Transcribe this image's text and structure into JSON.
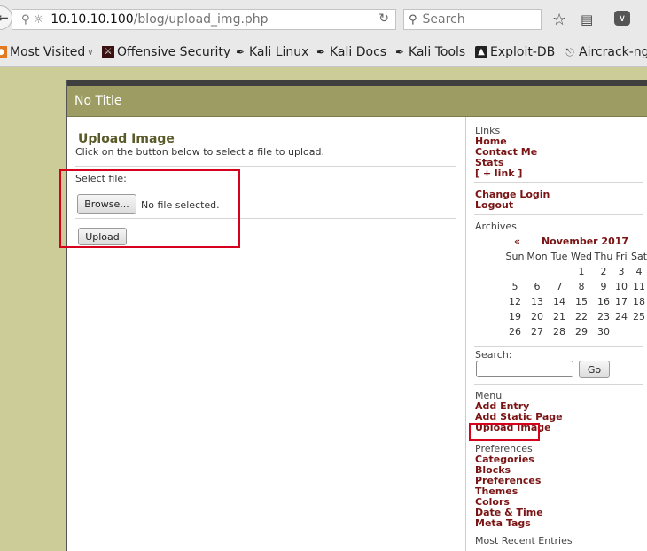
{
  "browser": {
    "url_host": "10.10.10.100",
    "url_path": "/blog/upload_img.php",
    "search_placeholder": "Search",
    "bookmarks": [
      "Most Visited",
      "Offensive Security",
      "Kali Linux",
      "Kali Docs",
      "Kali Tools",
      "Exploit-DB",
      "Aircrack-ng"
    ]
  },
  "page": {
    "header_title": "No Title",
    "upload": {
      "title": "Upload Image",
      "instruction": "Click on the button below to select a file to upload.",
      "select_label": "Select file:",
      "browse_label": "Browse...",
      "no_file": "No file selected.",
      "upload_label": "Upload"
    }
  },
  "sidebar": {
    "links_head": "Links",
    "links": [
      "Home",
      "Contact Me",
      "Stats",
      "[ + link ]"
    ],
    "account": [
      "Change Login",
      "Logout"
    ],
    "archives_head": "Archives",
    "calendar": {
      "prev": "«",
      "month": "November 2017",
      "next": "»",
      "days": [
        "Sun",
        "Mon",
        "Tue",
        "Wed",
        "Thu",
        "Fri",
        "Sat"
      ],
      "weeks": [
        [
          "",
          "",
          "",
          "1",
          "2",
          "3",
          "4"
        ],
        [
          "5",
          "6",
          "7",
          "8",
          "9",
          "10",
          "11"
        ],
        [
          "12",
          "13",
          "14",
          "15",
          "16",
          "17",
          "18"
        ],
        [
          "19",
          "20",
          "21",
          "22",
          "23",
          "24",
          "25"
        ],
        [
          "26",
          "27",
          "28",
          "29",
          "30",
          "",
          ""
        ]
      ]
    },
    "search_head": "Search:",
    "go_label": "Go",
    "menu_head": "Menu",
    "menu": [
      "Add Entry",
      "Add Static Page",
      "Upload Image"
    ],
    "prefs_head": "Preferences",
    "prefs": [
      "Categories",
      "Blocks",
      "Preferences",
      "Themes",
      "Colors",
      "Date & Time",
      "Meta Tags"
    ],
    "recent_head": "Most Recent Entries"
  },
  "colors": {
    "link": "#7a1414",
    "header_bg": "#9d9d63",
    "page_bg": "#cccc99",
    "highlight_box": "#d6001c"
  }
}
